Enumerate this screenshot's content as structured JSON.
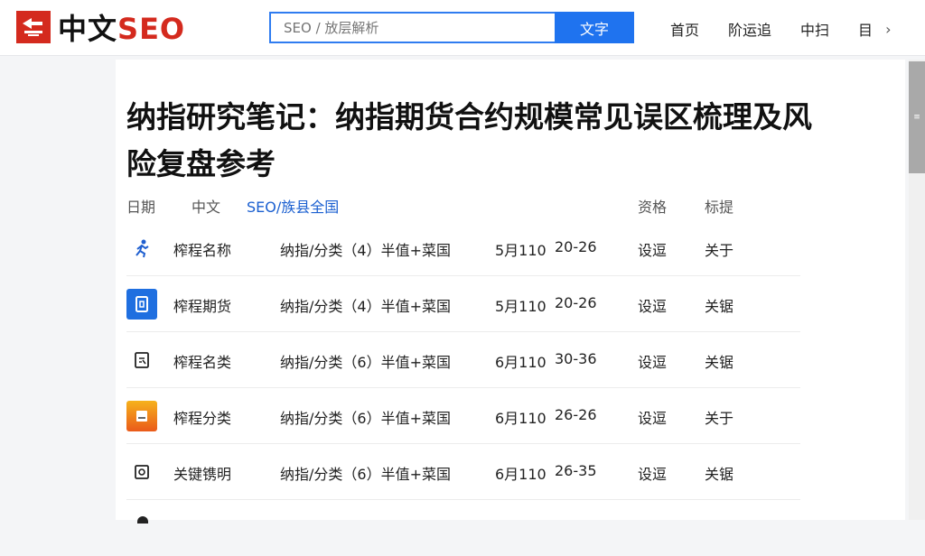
{
  "header": {
    "logo_cn": "中文",
    "logo_en": "SEO",
    "search_placeholder": "SEO / 放层解析",
    "search_button": "文字",
    "nav": [
      "首页",
      "阶运追",
      "中扫",
      "目"
    ]
  },
  "article": {
    "title": "纳指研究笔记：纳指期货合约规模常见误区梳理及风险复盘参考",
    "meta": {
      "date_label": "日期",
      "lang": "中文",
      "category_link": "SEO/族县全国",
      "col_status": "资格",
      "col_tag": "标提"
    },
    "rows": [
      {
        "icon": "runner-icon",
        "icon_bg": "#ffffff",
        "name": "榨程名称",
        "desc": "纳指/分类（4）半值+菜国",
        "date": "5月110",
        "range": "20-26",
        "status": "设逗",
        "tag": "关于"
      },
      {
        "icon": "document-icon",
        "icon_bg": "#1f6fe0",
        "name": "榨程期货",
        "desc": "纳指/分类（4）半值+菜国",
        "date": "5月110",
        "range": "20-26",
        "status": "设逗",
        "tag": "关锯"
      },
      {
        "icon": "clipboard-icon",
        "icon_bg": "#ffffff",
        "name": "榨程名类",
        "desc": "纳指/分类（6）半值+菜国",
        "date": "6月110",
        "range": "30-36",
        "status": "设逗",
        "tag": "关锯"
      },
      {
        "icon": "folder-icon",
        "icon_bg": "#f08a1c",
        "name": "榨程分类",
        "desc": "纳指/分类（6）半值+菜国",
        "date": "6月110",
        "range": "26-26",
        "status": "设逗",
        "tag": "关于"
      },
      {
        "icon": "image-icon",
        "icon_bg": "#ffffff",
        "name": "关键镌明",
        "desc": "纳指/分类（6）半值+菜国",
        "date": "6月110",
        "range": "26-35",
        "status": "设逗",
        "tag": "关锯"
      }
    ]
  }
}
